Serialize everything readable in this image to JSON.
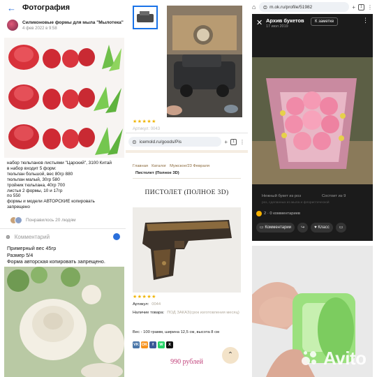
{
  "post": {
    "header_title": "Фотография",
    "author_name": "Силиконовые формы для мыла \"Мылотека\"",
    "date": "4 фев 2022 в 9:58",
    "description_lines": [
      "набор тюльпанов листьями \"Царский\", 3100 Китай",
      "в набор входит 5 форм:",
      "тюльпан большой, вес 80гр 880",
      "тюльпан малый, 30гр 580",
      "тройник тюльпана, 40гр 700",
      "листья 2 формы, 10 и 17гр",
      "по 550",
      "формы и модели АВТОРСКИЕ копировать",
      "запрещено"
    ],
    "likes_text": "Понравилось 20 людям",
    "comment_placeholder": "Комментарий",
    "bottom_lines": [
      "Примерный вес 45гр",
      "Размер 5/4",
      "Форма авторская копировать запрещено."
    ]
  },
  "listing": {
    "peek_text": "Артикул: 0043",
    "url": "icemold.ru/goods/Pis",
    "tab_count": "1",
    "breadcrumbs": [
      "Главная",
      "Каталог",
      "Мужское/23 Февраля"
    ],
    "breadcrumb_current": "Пистолет (Полное 3D)",
    "product_title": "ПИСТОЛЕТ (ПОЛНОЕ 3D)",
    "article_label": "Артикул:",
    "article_value": "0044",
    "availability_label": "Наличие товара:",
    "availability_value": "ПОД ЗАКАЗ(срок изготовления месяц)",
    "meta": "Вес - 100 грамм, ширина 12,5 см, высота 8 см",
    "price": "990 рублей",
    "share_buttons": [
      {
        "label": "VK",
        "color": "#4a76a8"
      },
      {
        "label": "OK",
        "color": "#f7931e"
      },
      {
        "label": "f",
        "color": "#3b5998"
      },
      {
        "label": "W",
        "color": "#25d366"
      },
      {
        "label": "X",
        "color": "#111111"
      }
    ]
  },
  "ok": {
    "url": "m.ok.ru/profile/51982",
    "tab_count": "1",
    "album_title": "Архив букетов",
    "album_date": "17 июл 2019",
    "bookmark_label": "К заметке",
    "related_left": "Нежный букет из роз",
    "related_right": "Состоит из 9",
    "related_sub": "роз, сделанных из мыла и флористической",
    "stats": "2 · 0 комментариев",
    "actions": [
      "Комментарии",
      "Класс"
    ]
  },
  "watermark": "Avito",
  "colors": {
    "link_blue": "#2a6fdb",
    "star": "#f0b400",
    "price": "#c0417a",
    "ok_orange": "#f7b100"
  }
}
